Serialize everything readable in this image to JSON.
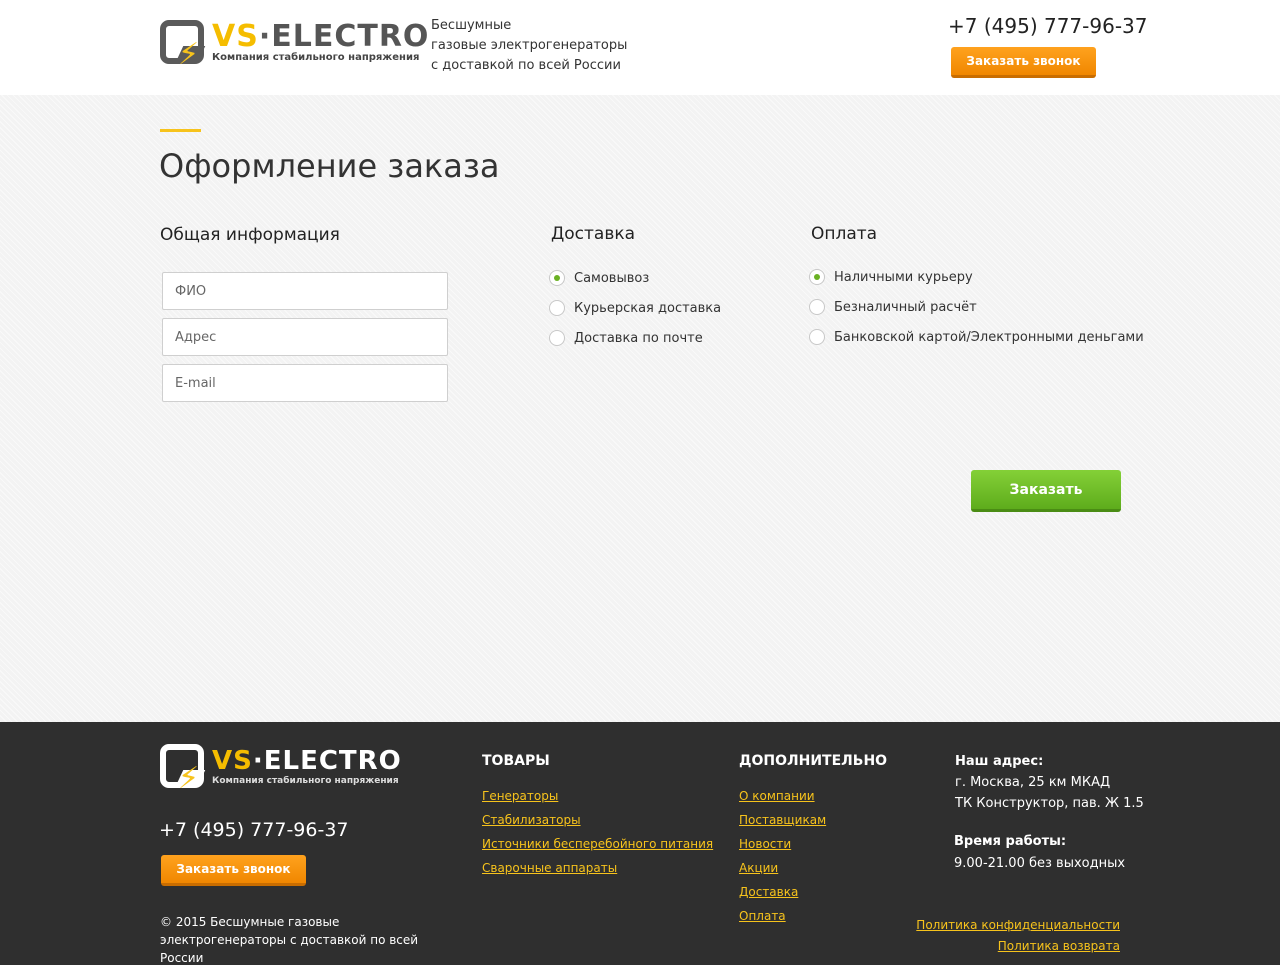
{
  "header": {
    "logo": {
      "brand_vs": "VS",
      "brand_dot": "·",
      "brand_electro": "ELECTRO",
      "subtitle": "Компания стабильного напряжения"
    },
    "tagline": [
      "Бесшумные",
      "газовые электрогенераторы",
      "с доставкой по всей России"
    ],
    "phone": "+7 (495) 777-96-37",
    "callback_label": "Заказать звонок"
  },
  "main": {
    "title": "Оформление заказа",
    "info": {
      "title": "Общая информация",
      "fields": [
        {
          "placeholder": "ФИО",
          "value": ""
        },
        {
          "placeholder": "Адрес",
          "value": ""
        },
        {
          "placeholder": "E-mail",
          "value": ""
        }
      ]
    },
    "delivery": {
      "title": "Доставка",
      "options": [
        "Самовывоз",
        "Курьерская доставка",
        "Доставка по почте"
      ],
      "selected": "Самовывоз"
    },
    "payment": {
      "title": "Оплата",
      "options": [
        "Наличными курьеру",
        "Безналичный расчёт",
        "Банковской картой/Электронными деньгами"
      ],
      "selected": "Наличными курьеру"
    },
    "submit_label": "Заказать"
  },
  "footer": {
    "logo": {
      "brand_vs": "VS",
      "brand_dot": "·",
      "brand_electro": "ELECTRO",
      "subtitle": "Компания стабильного напряжения"
    },
    "phone": "+7 (495) 777-96-37",
    "callback_label": "Заказать звонок",
    "copyright": [
      "© 2015 Бесшумные газовые",
      "электрогенераторы с доставкой по всей России"
    ],
    "goods": {
      "title": "ТОВАРЫ",
      "links": [
        "Генераторы",
        "Стабилизаторы",
        "Источники бесперебойного питания",
        "Сварочные аппараты"
      ]
    },
    "extra": {
      "title": "ДОПОЛНИТЕЛЬНО",
      "links": [
        "О компании",
        "Поставщикам",
        "Новости",
        "Акции",
        "Доставка",
        "Оплата"
      ]
    },
    "address": {
      "label": "Наш адрес:",
      "lines": [
        "г. Москва, 25 км МКАД",
        "ТК Конструктор, пав. Ж 1.5"
      ]
    },
    "hours": {
      "label": "Время работы:",
      "value": "9.00-21.00 без выходных"
    },
    "policy": [
      "Политика конфиденциальности",
      "Политика возврата"
    ]
  },
  "colors": {
    "accent": "#f7c31c",
    "orange_button": "#f59300",
    "green_button": "#6ab123",
    "footer_bg": "#2f2f2f"
  }
}
